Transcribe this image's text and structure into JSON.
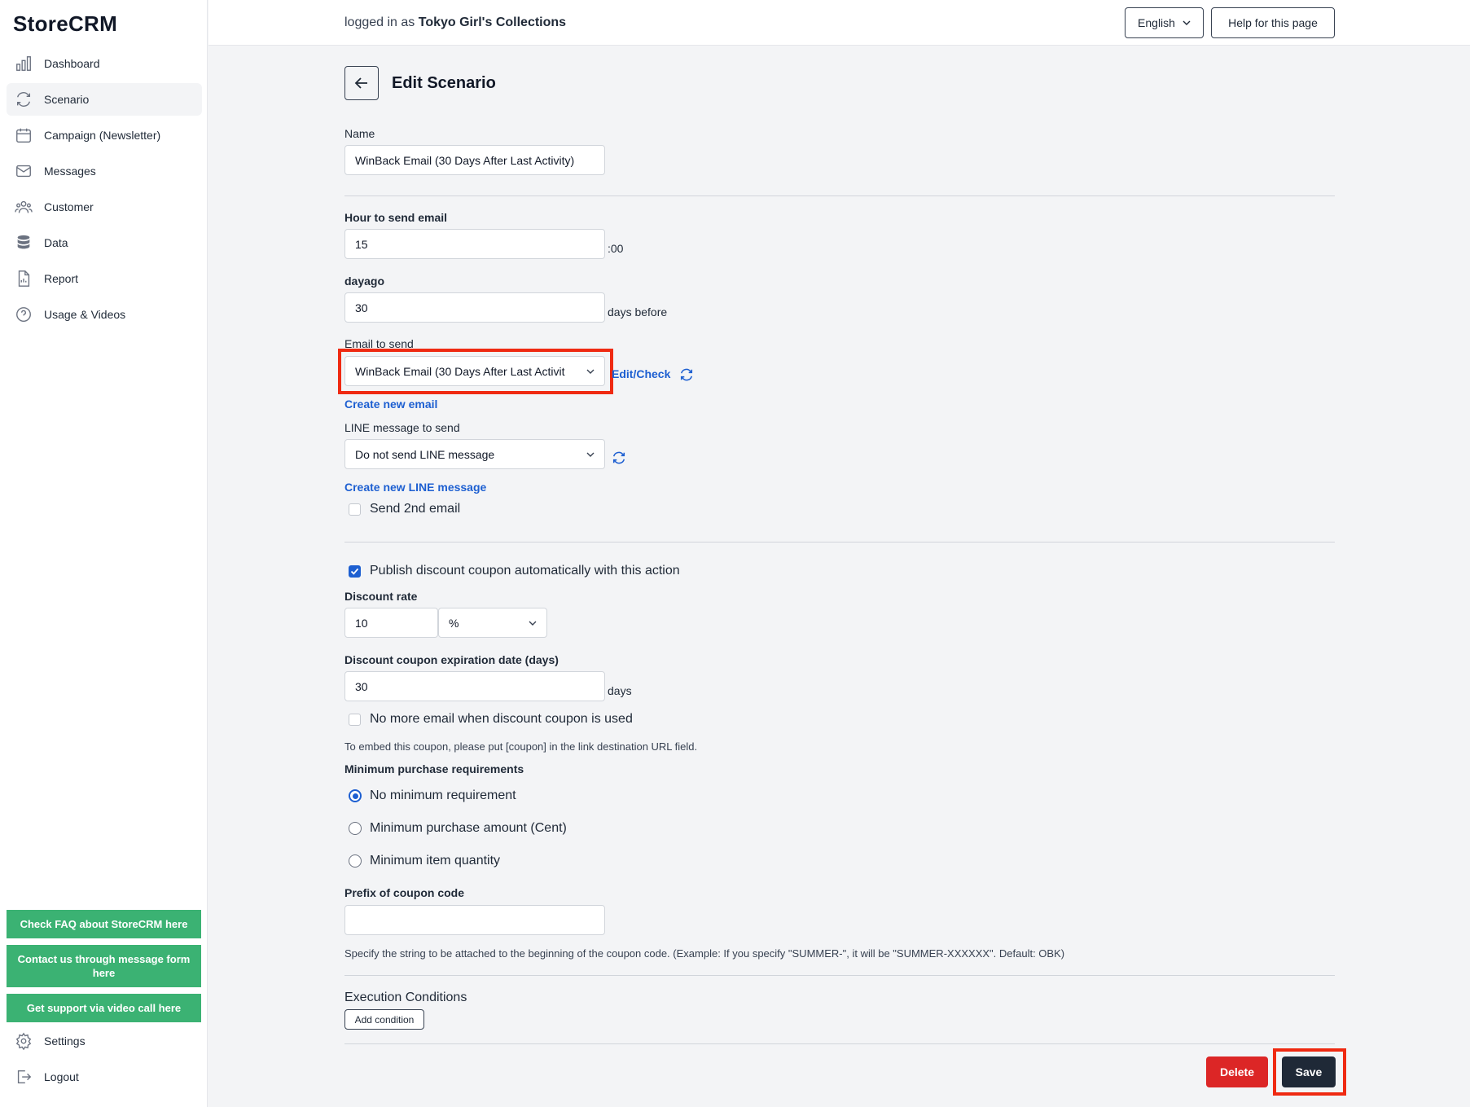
{
  "app": {
    "logo": "StoreCRM"
  },
  "sidebar": {
    "items": [
      {
        "label": "Dashboard",
        "icon": "chart-bar-icon"
      },
      {
        "label": "Scenario",
        "icon": "refresh-cycle-icon",
        "active": true
      },
      {
        "label": "Campaign (Newsletter)",
        "icon": "calendar-icon"
      },
      {
        "label": "Messages",
        "icon": "envelope-icon"
      },
      {
        "label": "Customer",
        "icon": "users-icon"
      },
      {
        "label": "Data",
        "icon": "database-icon"
      },
      {
        "label": "Report",
        "icon": "document-report-icon"
      },
      {
        "label": "Usage & Videos",
        "icon": "question-circle-icon"
      }
    ],
    "help_buttons": [
      "Check FAQ about StoreCRM here",
      "Contact us through message form here",
      "Get support via video call here"
    ],
    "bottom_items": [
      {
        "label": "Settings",
        "icon": "gear-icon"
      },
      {
        "label": "Logout",
        "icon": "logout-icon"
      }
    ]
  },
  "header": {
    "logged_prefix": "logged in as ",
    "store_name": "Tokyo Girl's Collections",
    "language": "English",
    "help": "Help for this page"
  },
  "page": {
    "title": "Edit Scenario"
  },
  "form": {
    "name_label": "Name",
    "name_value": "WinBack Email (30 Days After Last Activity)",
    "hour_label": "Hour to send email",
    "hour_value": "15",
    "hour_suffix": ":00",
    "dayago_label": "dayago",
    "dayago_value": "30",
    "dayago_suffix": "days before",
    "email_label": "Email to send",
    "email_value": "WinBack Email (30 Days After Last Activit",
    "edit_check": "Edit/Check",
    "create_email": "Create new email",
    "line_label": "LINE message to send",
    "line_value": "Do not send LINE message",
    "create_line": "Create new LINE message",
    "second_email": "Send 2nd email",
    "publish_coupon": "Publish discount coupon automatically with this action",
    "discount_rate_label": "Discount rate",
    "discount_rate_value": "10",
    "discount_unit": "%",
    "expiration_label": "Discount coupon expiration date (days)",
    "expiration_value": "30",
    "expiration_suffix": "days",
    "no_more_email": "No more email when discount coupon is used",
    "embed_note": "To embed this coupon, please put [coupon] in the link destination URL field.",
    "min_purchase_label": "Minimum purchase requirements",
    "min_options": [
      "No minimum requirement",
      "Minimum purchase amount (Cent)",
      "Minimum item quantity"
    ],
    "prefix_label": "Prefix of coupon code",
    "prefix_value": "",
    "prefix_note": "Specify the string to be attached to the beginning of the coupon code. (Example: If you specify \"SUMMER-\", it will be \"SUMMER-XXXXXX\". Default: OBK)",
    "conditions_label": "Execution Conditions",
    "add_condition": "Add condition"
  },
  "actions": {
    "delete": "Delete",
    "save": "Save"
  },
  "colors": {
    "accent": "#1d5fd1",
    "green": "#3bb273",
    "danger": "#dc2626",
    "dark": "#1f2937",
    "highlight": "#ef2a12"
  }
}
